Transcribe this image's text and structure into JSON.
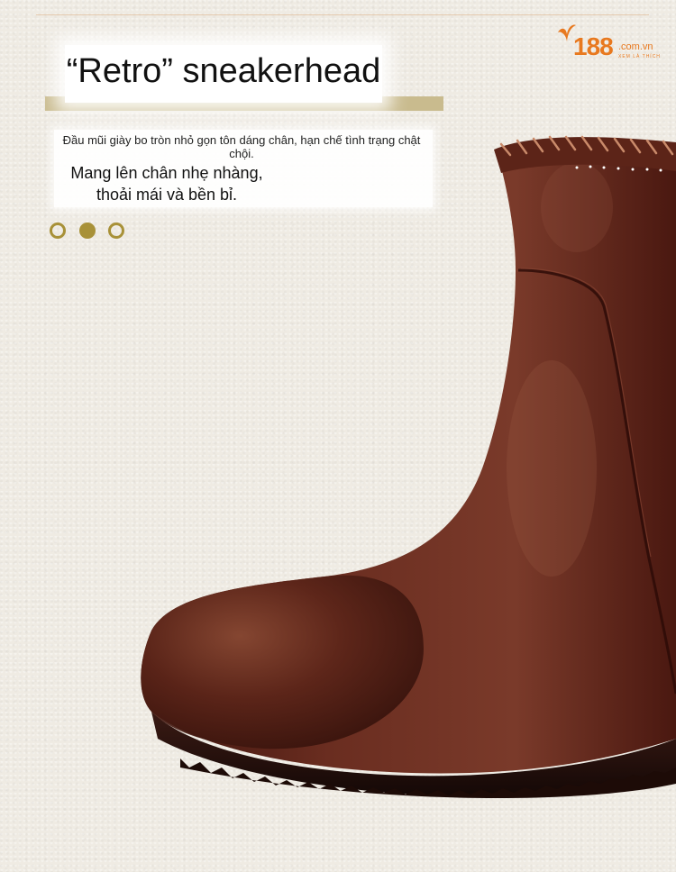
{
  "logo": {
    "number": "188",
    "domain": ".com.vn",
    "tagline": "XEM LÀ THÍCH"
  },
  "headline": "“Retro” sneakerhead",
  "description": {
    "line_small": "Đầu mũi giày bo tròn nhỏ gọn tôn dáng chân, hạn chế tình trạng chật chội.",
    "line_large": "Mang lên chân nhẹ nhàng, thoải mái và bền bỉ."
  },
  "carousel": {
    "slides": 3,
    "active_index": 1
  },
  "product": {
    "image_icon": "leather-ankle-boot-photo"
  },
  "colors": {
    "accent_gold": "#a89138",
    "band_tan": "#c9bb8e",
    "logo_orange": "#e8791f",
    "boot_brown": "#5a2418",
    "background": "#efebe3"
  }
}
